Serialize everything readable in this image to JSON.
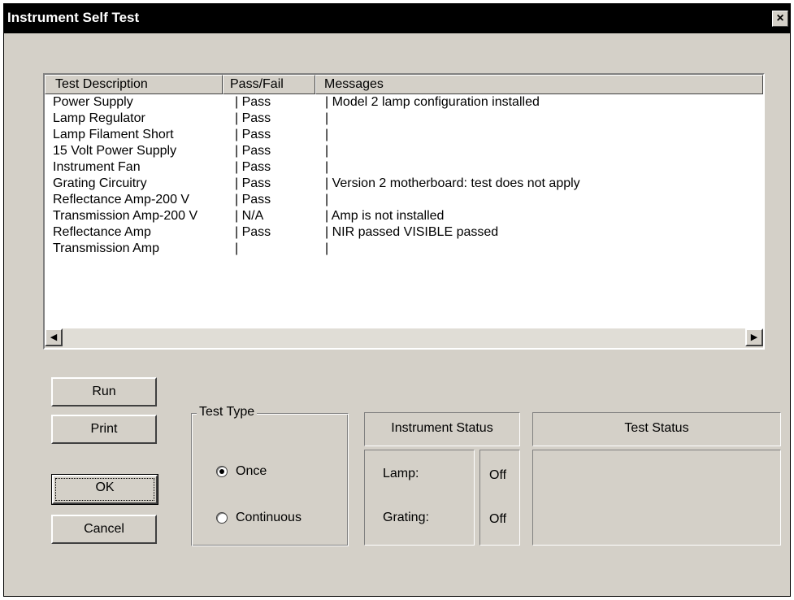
{
  "window": {
    "title": "Instrument Self Test",
    "close_label": "×"
  },
  "listview": {
    "columns": [
      "Test Description",
      "Pass/Fail",
      "Messages"
    ],
    "rows": [
      {
        "description": "Power Supply",
        "result": "| Pass",
        "message": "| Model 2 lamp configuration installed"
      },
      {
        "description": "Lamp Regulator",
        "result": "| Pass",
        "message": "|"
      },
      {
        "description": "Lamp Filament Short",
        "result": "| Pass",
        "message": "|"
      },
      {
        "description": "15 Volt Power Supply",
        "result": "| Pass",
        "message": "|"
      },
      {
        "description": "Instrument Fan",
        "result": "| Pass",
        "message": "|"
      },
      {
        "description": "Grating Circuitry",
        "result": "| Pass",
        "message": "| Version 2 motherboard: test does not apply"
      },
      {
        "description": "Reflectance Amp-200 V",
        "result": "| Pass",
        "message": "|"
      },
      {
        "description": "Transmission Amp-200 V",
        "result": "| N/A",
        "message": "| Amp is not installed"
      },
      {
        "description": "Reflectance Amp",
        "result": "| Pass",
        "message": "| NIR passed   VISIBLE passed"
      },
      {
        "description": "Transmission Amp",
        "result": "|",
        "message": "|"
      }
    ],
    "scroll_left": "◀",
    "scroll_right": "▶"
  },
  "buttons": {
    "run": "Run",
    "print": "Print",
    "ok": "OK",
    "cancel": "Cancel"
  },
  "test_type": {
    "legend": "Test Type",
    "options": [
      "Once",
      "Continuous"
    ],
    "selected": "Once"
  },
  "instrument_status": {
    "title": "Instrument Status",
    "lamp_label": "Lamp:",
    "lamp_value": "Off",
    "grating_label": "Grating:",
    "grating_value": "Off"
  },
  "test_status": {
    "title": "Test Status",
    "value": ""
  }
}
